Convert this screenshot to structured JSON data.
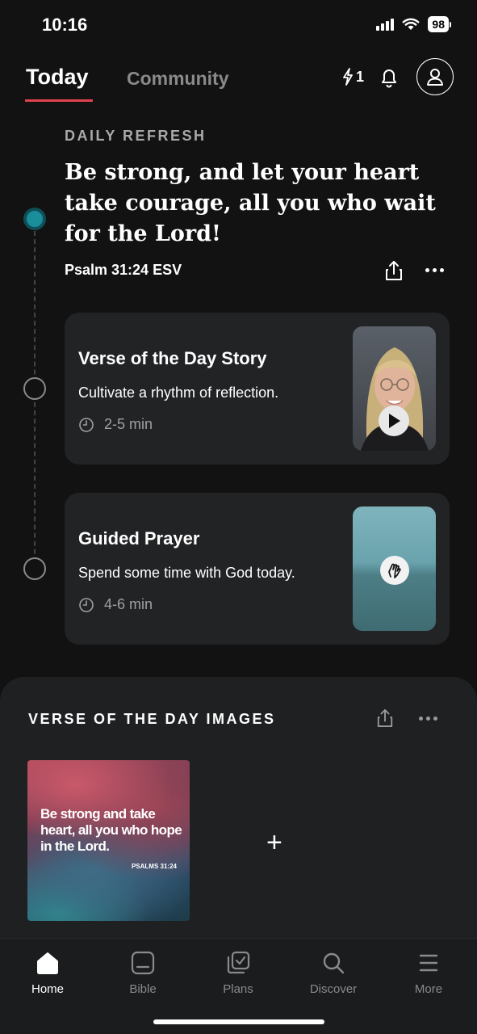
{
  "status_bar": {
    "time": "10:16",
    "battery": "98"
  },
  "header": {
    "tabs": [
      {
        "label": "Today",
        "active": true
      },
      {
        "label": "Community",
        "active": false
      }
    ],
    "streak_count": "1",
    "icons": [
      "streak-icon",
      "bell-icon",
      "profile-icon"
    ]
  },
  "daily_refresh": {
    "label": "DAILY REFRESH",
    "verse": "Be strong, and let your heart take courage, all you who wait for the Lord!",
    "reference": "Psalm 31:24 ESV"
  },
  "cards": [
    {
      "title": "Verse of the Day Story",
      "description": "Cultivate a rhythm of reflection.",
      "duration": "2-5 min",
      "thumb_icon": "play-icon"
    },
    {
      "title": "Guided Prayer",
      "description": "Spend some time with God today.",
      "duration": "4-6 min",
      "thumb_icon": "praying-hands-icon"
    }
  ],
  "votd_images": {
    "title": "VERSE OF THE DAY IMAGES",
    "image_text": "Be strong and take heart, all you who hope in the Lord.",
    "image_reference": "PSALMS 31:24",
    "add_label": "+"
  },
  "bottom_nav": [
    {
      "label": "Home",
      "icon": "home-icon",
      "active": true
    },
    {
      "label": "Bible",
      "icon": "bible-icon",
      "active": false
    },
    {
      "label": "Plans",
      "icon": "plans-icon",
      "active": false
    },
    {
      "label": "Discover",
      "icon": "search-icon",
      "active": false
    },
    {
      "label": "More",
      "icon": "menu-icon",
      "active": false
    }
  ],
  "colors": {
    "background": "#121212",
    "card": "#222325",
    "accent_red": "#e0434f",
    "timeline_active": "#1a8e9a"
  }
}
